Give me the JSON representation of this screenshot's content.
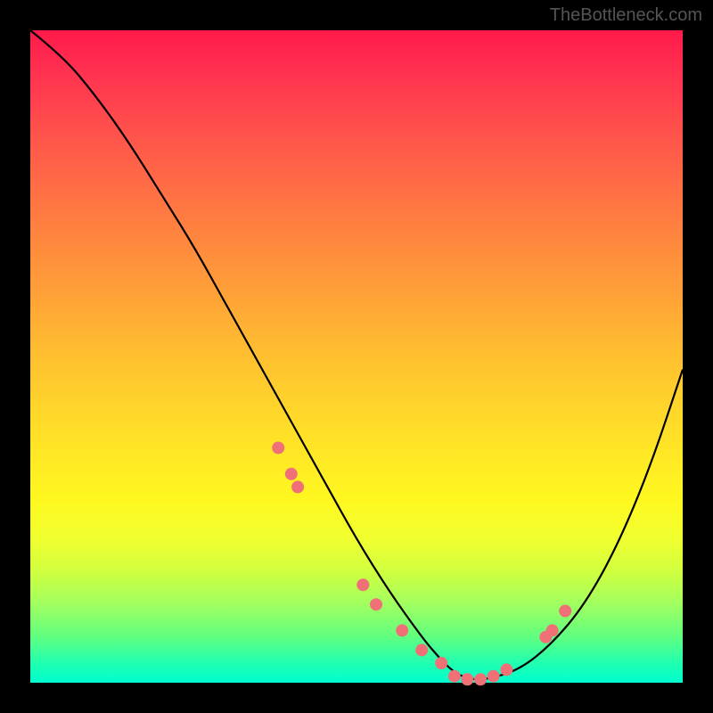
{
  "watermark": "TheBottleneck.com",
  "chart_data": {
    "type": "line",
    "title": "",
    "xlabel": "",
    "ylabel": "",
    "xlim": [
      0,
      100
    ],
    "ylim": [
      0,
      100
    ],
    "series": [
      {
        "name": "curve",
        "x": [
          0,
          5,
          10,
          15,
          20,
          25,
          30,
          35,
          40,
          45,
          50,
          55,
          60,
          62.5,
          65,
          67.5,
          70,
          75,
          80,
          85,
          90,
          95,
          100
        ],
        "values": [
          100,
          96,
          90,
          83,
          75,
          67,
          58,
          49,
          40,
          31,
          22,
          14,
          7,
          4,
          1.5,
          0.5,
          0.5,
          2,
          6,
          12,
          21,
          33,
          48
        ]
      }
    ],
    "scatter": {
      "name": "markers",
      "x": [
        38,
        40,
        41,
        51,
        53,
        57,
        60,
        63,
        65,
        67,
        69,
        71,
        73,
        79,
        80,
        82
      ],
      "values": [
        36,
        32,
        30,
        15,
        12,
        8,
        5,
        3,
        1,
        0.5,
        0.5,
        1,
        2,
        7,
        8,
        11
      ]
    },
    "background": {
      "type": "gradient",
      "top_color": "#ff1a4a",
      "mid_color": "#ffe028",
      "bottom_color": "#00ffd0"
    }
  }
}
